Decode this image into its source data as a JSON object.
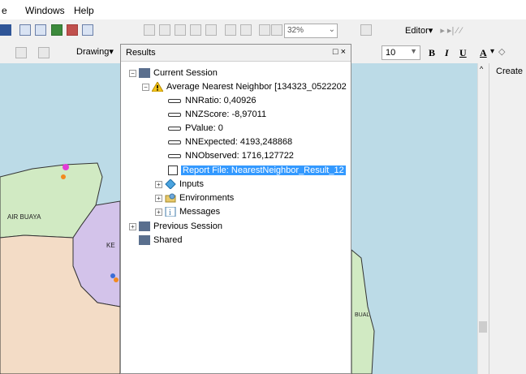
{
  "menu": {
    "frag": "e",
    "windows": "Windows",
    "help": "Help"
  },
  "toolbar": {
    "zoom_percent": "32%",
    "editor_label": "Editor",
    "drawing_label": "Drawing",
    "font_size": "10",
    "bold": "B",
    "italic": "I",
    "underline": "U",
    "font_color": "A"
  },
  "results": {
    "title": "Results",
    "title_controls": "□ ×",
    "current_session": "Current Session",
    "tool": "Average Nearest Neighbor [134323_0522202",
    "values": [
      "NNRatio: 0,40926",
      "NNZScore: -8,97011",
      "PValue: 0",
      "NNExpected: 4193,248868",
      "NNObserved: 1716,127722"
    ],
    "report": "Report File: NearestNeighbor_Result_12",
    "inputs": "Inputs",
    "environments": "Environments",
    "messages": "Messages",
    "previous_session": "Previous Session",
    "shared": "Shared"
  },
  "map": {
    "label_air_buaya": "AIR BUAYA",
    "label_ke": "KE",
    "label_bual": "BUAL"
  },
  "create_panel": {
    "title": "Create"
  },
  "colors": {
    "water": "#bcdbe7",
    "land_green": "#d1eac3",
    "land_purple": "#d3c3ea",
    "land_tan": "#f3dcc6",
    "selection": "#3399ff"
  }
}
